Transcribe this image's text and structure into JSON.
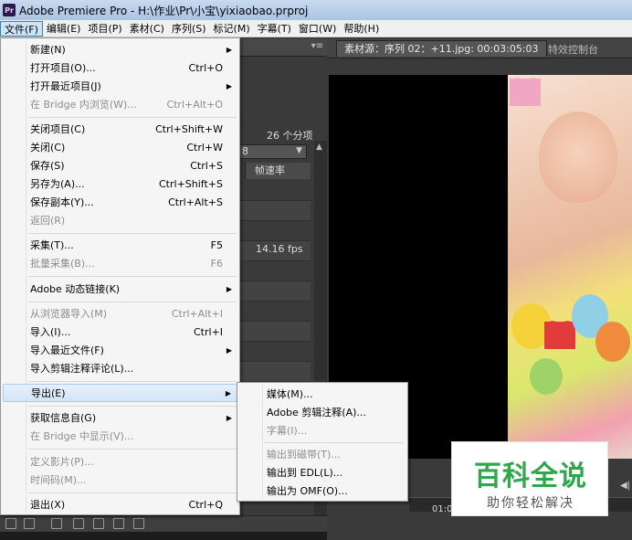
{
  "window": {
    "title": "Adobe Premiere Pro - H:\\作业\\Pr\\小宝\\yixiaobao.prproj",
    "app_icon": "Pr"
  },
  "menubar": [
    {
      "label": "文件(F)",
      "active": true
    },
    {
      "label": "编辑(E)"
    },
    {
      "label": "项目(P)"
    },
    {
      "label": "素材(C)"
    },
    {
      "label": "序列(S)"
    },
    {
      "label": "标记(M)"
    },
    {
      "label": "字幕(T)"
    },
    {
      "label": "窗口(W)"
    },
    {
      "label": "帮助(H)"
    }
  ],
  "project_panel": {
    "items_count": "26 个分项",
    "column_frame_rate": "帧速率",
    "fps_value": "14.16 fps",
    "dropdown_value": "8"
  },
  "source_monitor": {
    "tab_source": "素材源：序列 02：+11.jpg: 00:03:05:03",
    "tab_effects": "特效控制台",
    "timecode": "01:0"
  },
  "file_menu": {
    "items": [
      {
        "label": "新建(N)",
        "shortcut": "",
        "submenu": true,
        "disabled": false
      },
      {
        "label": "打开项目(O)...",
        "shortcut": "Ctrl+O",
        "submenu": false,
        "disabled": false
      },
      {
        "label": "打开最近项目(J)",
        "shortcut": "",
        "submenu": true,
        "disabled": false
      },
      {
        "label": "在 Bridge 内浏览(W)...",
        "shortcut": "Ctrl+Alt+O",
        "submenu": false,
        "disabled": true
      },
      {
        "label": "关闭项目(C)",
        "shortcut": "Ctrl+Shift+W",
        "submenu": false,
        "disabled": false
      },
      {
        "label": "关闭(C)",
        "shortcut": "Ctrl+W",
        "submenu": false,
        "disabled": false
      },
      {
        "label": "保存(S)",
        "shortcut": "Ctrl+S",
        "submenu": false,
        "disabled": false
      },
      {
        "label": "另存为(A)...",
        "shortcut": "Ctrl+Shift+S",
        "submenu": false,
        "disabled": false
      },
      {
        "label": "保存副本(Y)...",
        "shortcut": "Ctrl+Alt+S",
        "submenu": false,
        "disabled": false
      },
      {
        "label": "返回(R)",
        "shortcut": "",
        "submenu": false,
        "disabled": true
      },
      {
        "label": "采集(T)...",
        "shortcut": "F5",
        "submenu": false,
        "disabled": false
      },
      {
        "label": "批量采集(B)...",
        "shortcut": "F6",
        "submenu": false,
        "disabled": true
      },
      {
        "label": "Adobe 动态链接(K)",
        "shortcut": "",
        "submenu": true,
        "disabled": false
      },
      {
        "label": "从浏览器导入(M)",
        "shortcut": "Ctrl+Alt+I",
        "submenu": false,
        "disabled": true
      },
      {
        "label": "导入(I)...",
        "shortcut": "Ctrl+I",
        "submenu": false,
        "disabled": false
      },
      {
        "label": "导入最近文件(F)",
        "shortcut": "",
        "submenu": true,
        "disabled": false
      },
      {
        "label": "导入剪辑注释评论(L)...",
        "shortcut": "",
        "submenu": false,
        "disabled": false
      },
      {
        "label": "导出(E)",
        "shortcut": "",
        "submenu": true,
        "disabled": false,
        "highlight": true
      },
      {
        "label": "获取信息自(G)",
        "shortcut": "",
        "submenu": true,
        "disabled": false
      },
      {
        "label": "在 Bridge 中显示(V)...",
        "shortcut": "",
        "submenu": false,
        "disabled": true
      },
      {
        "label": "定义影片(P)...",
        "shortcut": "",
        "submenu": false,
        "disabled": true
      },
      {
        "label": "时间码(M)...",
        "shortcut": "",
        "submenu": false,
        "disabled": true
      },
      {
        "label": "退出(X)",
        "shortcut": "Ctrl+Q",
        "submenu": false,
        "disabled": false
      }
    ]
  },
  "export_submenu": {
    "items": [
      {
        "label": "媒体(M)...",
        "disabled": false
      },
      {
        "label": "Adobe 剪辑注释(A)...",
        "disabled": false
      },
      {
        "label": "字幕(I)...",
        "disabled": true
      },
      {
        "label": "输出到磁带(T)...",
        "disabled": true
      },
      {
        "label": "输出到 EDL(L)...",
        "disabled": false
      },
      {
        "label": "输出为 OMF(O)...",
        "disabled": false
      }
    ]
  },
  "watermark": {
    "title": "百科全说",
    "subtitle": "助你轻松解决",
    "color": "#2ea84a"
  }
}
